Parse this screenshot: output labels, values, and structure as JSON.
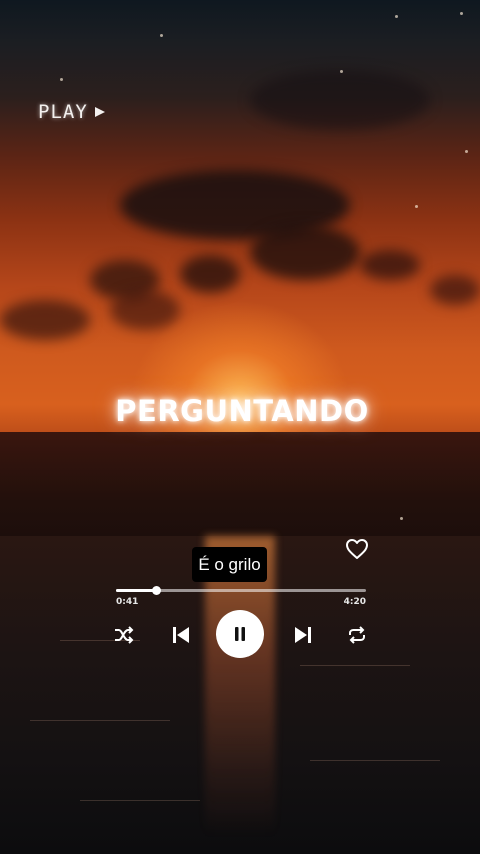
{
  "overlay": {
    "label": "PLAY"
  },
  "song": {
    "title": "PERGUNTANDO"
  },
  "lyric": {
    "caption": "É o grilo"
  },
  "player": {
    "elapsed": "0:41",
    "total": "4:20",
    "progress": 0.16,
    "liked": false,
    "state": "playing"
  },
  "icons": {
    "overlay": "play-triangle-icon",
    "like": "heart-icon",
    "shuffle": "shuffle-icon",
    "previous": "skip-previous-icon",
    "pause": "pause-icon",
    "next": "skip-next-icon",
    "repeat": "repeat-icon"
  },
  "colors": {
    "sky_top": "#0f1820",
    "sunset": "#d8601e",
    "sea": "#141112",
    "text": "#ffffff",
    "caption_bg": "#000000"
  }
}
